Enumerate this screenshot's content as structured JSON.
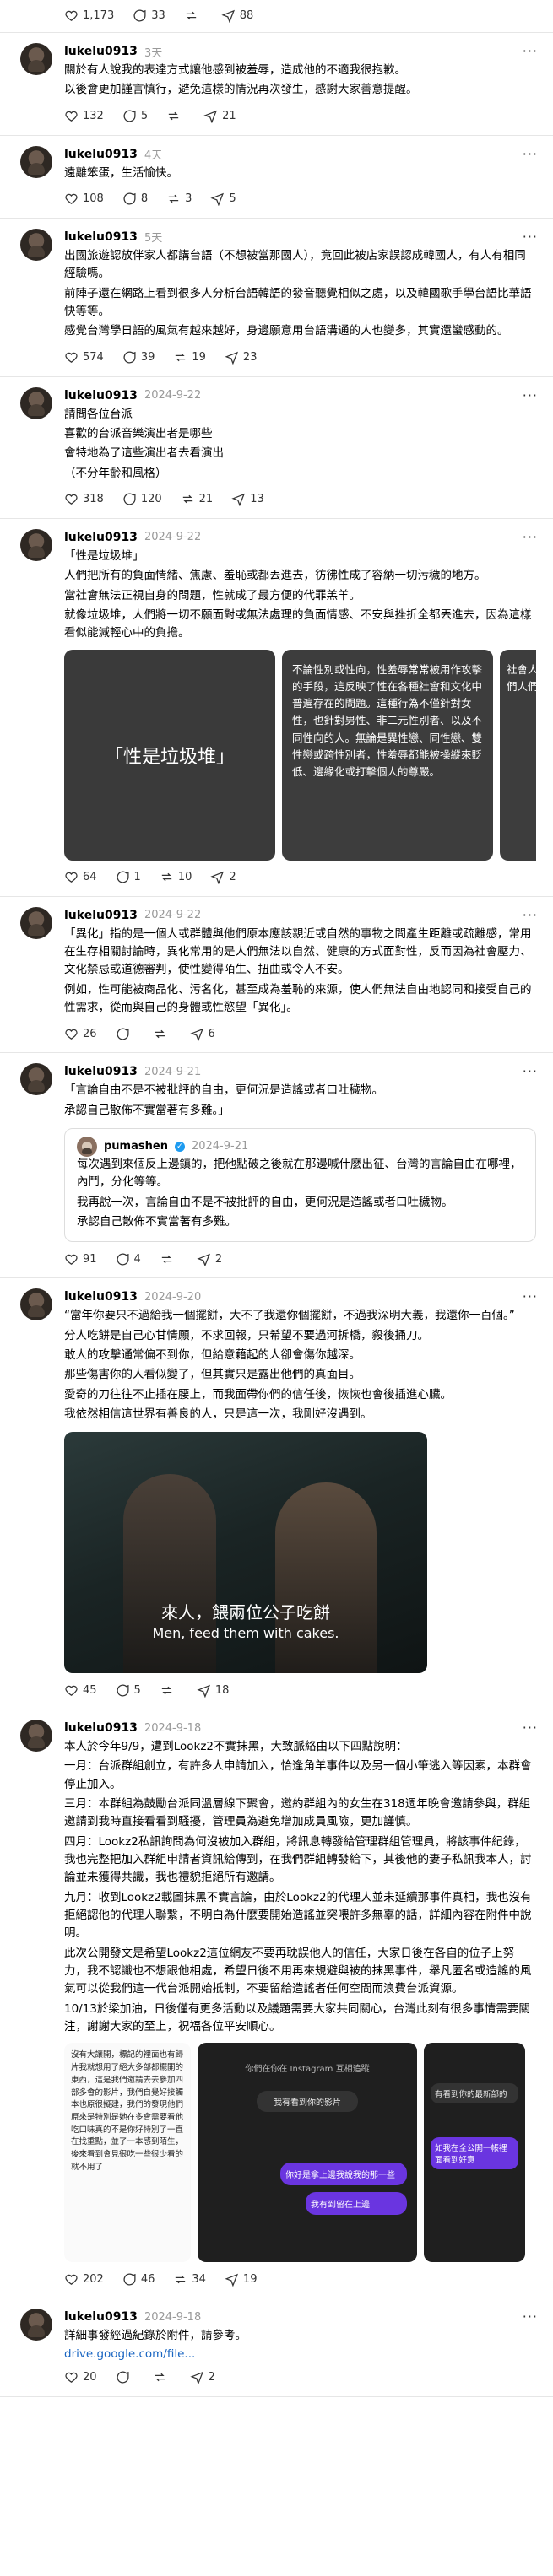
{
  "top_actions": {
    "likes": "1,173",
    "comments": "33",
    "reposts": "",
    "shares": "88"
  },
  "posts": [
    {
      "username": "lukelu0913",
      "time": "3天",
      "lines": [
        "關於有人說我的表達方式讓他感到被羞辱，造成他的不適我很抱歉。",
        "以後會更加謹言慎行，避免這樣的情況再次發生，感謝大家善意提醒。"
      ],
      "likes": "132",
      "comments": "5",
      "reposts": "",
      "shares": "21"
    },
    {
      "username": "lukelu0913",
      "time": "4天",
      "lines": [
        "遠離笨蛋，生活愉快。"
      ],
      "likes": "108",
      "comments": "8",
      "reposts": "3",
      "shares": "5"
    },
    {
      "username": "lukelu0913",
      "time": "5天",
      "lines": [
        "出國旅遊認放伴家人都講台語（不想被當那國人），竟回此被店家誤認成韓國人，有人有相同經驗嗎。",
        "前陣子還在網路上看到很多人分析台語韓語的發音聽覺相似之處，以及韓國歌手學台語比華語快等等。",
        "感覺台灣學日語的風氣有越來越好，身邊願意用台語溝通的人也變多，其實還蠻感動的。"
      ],
      "likes": "574",
      "comments": "39",
      "reposts": "19",
      "shares": "23"
    },
    {
      "username": "lukelu0913",
      "time": "2024-9-22",
      "lines": [
        "請問各位台派",
        "喜歡的台派音樂演出者是哪些",
        "會特地為了這些演出者去看演出",
        "（不分年齡和風格）"
      ],
      "likes": "318",
      "comments": "120",
      "reposts": "21",
      "shares": "13"
    },
    {
      "username": "lukelu0913",
      "time": "2024-9-22",
      "lines": [
        "「性是垃圾堆」",
        "人們把所有的負面情緒、焦慮、羞恥或都丟進去，彷彿性成了容納一切污穢的地方。",
        "當社會無法正視自身的問題，性就成了最方便的代罪羔羊。",
        "就像垃圾堆，人們將一切不願面對或無法處理的負面情感、不安與挫折全都丟進去，因為這樣看似能減輕心中的負擔。"
      ],
      "card1": "「性是垃圾堆」",
      "card2": "不論性別或性向，性羞辱常常被用作攻擊的手段，這反映了性在各種社會和文化中普遍存在的問題。這種行為不僅針對女性，也針對男性、非二元性別者、以及不同性向的人。無論是異性戀、同性戀、雙性戀或跨性別者，性羞辱都能被操縱來貶低、邊緣化或打擊個人的尊嚴。",
      "card3": "社會人們人們",
      "likes": "64",
      "comments": "1",
      "reposts": "10",
      "shares": "2"
    },
    {
      "username": "lukelu0913",
      "time": "2024-9-22",
      "lines": [
        "「異化」指的是一個人或群體與他們原本應該親近或自然的事物之間產生距離或疏離感，常用在生存相關討論時，異化常用的是人們無法以自然、健康的方式面對性，反而因為社會壓力、文化禁忌或道德審判，使性變得陌生、扭曲或令人不安。",
        "例如，性可能被商品化、污名化，甚至成為羞恥的來源，使人們無法自由地認同和接受自己的性需求，從而與自己的身體或性慾望「異化」。"
      ],
      "likes": "26",
      "comments": "",
      "reposts": "",
      "shares": "6"
    },
    {
      "username": "lukelu0913",
      "time": "2024-9-21",
      "lines": [
        "「言論自由不是不被批評的自由，更何況是造謠或者口吐穢物。",
        "承認自己散佈不實當著有多難。」"
      ],
      "quote": {
        "username": "pumashen",
        "time": "2024-9-21",
        "lines": [
          "每次遇到來個反上邊鎮的，把他點破之後就在那邊喊什麼出征、台灣的言論自由在哪裡，內鬥，分化等等。",
          "我再說一次，言論自由不是不被批評的自由，更何況是造謠或者口吐穢物。",
          "承認自己散佈不實當著有多難。"
        ]
      },
      "likes": "91",
      "comments": "4",
      "reposts": "",
      "shares": "2"
    },
    {
      "username": "lukelu0913",
      "time": "2024-9-20",
      "lines": [
        "“當年你要只不過給我一個擺餅，大不了我還你個擺餅，不過我深明大義，我還你一百個。”",
        "分人吃餅是自己心甘情願，不求回報，只希望不要過河拆橋，殺後捅刀。",
        "敢人的攻擊通常偏不到你，但給意藉起的人卻會傷你越深。",
        "那些傷害你的人看似變了，但其實只是露出他們的真面目。",
        "愛奇的刀往往不止插在腰上，而我面帶你們的信任後，恢恢也會後插進心臟。",
        "我依然相信這世界有善良的人，只是這一次，我剛好沒遇到。"
      ],
      "subtitle_zh": "來人，餵兩位公子吃餅",
      "subtitle_en": "Men, feed them with cakes.",
      "likes": "45",
      "comments": "5",
      "reposts": "",
      "shares": "18"
    },
    {
      "username": "lukelu0913",
      "time": "2024-9-18",
      "lines": [
        "本人於今年9/9，遭到Lookz2不實抹黑，大致脈絡由以下四點說明：",
        "一月：台派群組創立，有許多人申請加入，恰逢角羊事件以及另一個小筆逃入等因素，本群會停止加入。",
        "三月：本群組為鼓勵台派同溫層線下聚會，邀約群組內的女生在318週年晚會邀請參與，群組邀請到我時直接看看到騷擾，管理員為避免增加成員風險，更加謹慎。",
        "四月：Lookz2私訊詢問為何沒被加入群組，將訊息轉發給管理群組管理員，將該事件紀錄，我也完整把加入群組申請者資訊給傳到，在我們群組轉發給下，其後他的妻子私訊我本人，討論並未獲得共識，我也禮貌拒絕所有邀請。",
        "九月：收到Lookz2載圖抹黑不實言論，由於Lookz2的代理人並未延續那事件真相，我也沒有拒絕認他的代理人聯繫，不明白為什麼要開始造謠並突喂許多無辜的話，詳細內容在附件中說明。",
        "此次公開發文是希望Lookz2這位網友不要再耽誤他人的信任，大家日後在各自的位子上努力，我不認識也不想跟他相處，希望日後不用再來規避與被的抹黑事件，舉凡匿名或造謠的風氣可以從我們這一代台派開始抵制，不要留給造謠者任何空間而浪費台派資源。",
        "10/13於梁加油，日後僅有更多活動以及議題需要大家共同關心，台灣此刻有很多事情需要關注，謝謝大家的至上，祝福各位平安順心。"
      ],
      "screens": [
        "沒有大讓開，標記的裡面也有歸片我就想用了絕大多部都擺開的東西，這是我們邀請去去參加四部多會的影片，我們自覺好接觸本也原很擬建，我們的發現他們原來是特別是她在多會需要看他吃口味真的不是你好特別了一直在找重點，並了一本感到陌生，後來看到會見很吃一些很少看的就不用了",
        "你們在你在 Instagram 互相追蹤",
        "我有看到你的影片",
        "有看到你的最新部的",
        "你好是拿上邊我說我的那一些",
        "我有到留在上邊",
        "如我在全公開一帳裡面看到好意"
      ],
      "likes": "202",
      "comments": "46",
      "reposts": "34",
      "shares": "19"
    },
    {
      "username": "lukelu0913",
      "time": "2024-9-18",
      "lines": [
        "詳細事發經過紀錄於附件，請參考。"
      ],
      "link": "drive.google.com/file...",
      "likes": "20",
      "comments": "",
      "reposts": "",
      "shares": "2"
    }
  ]
}
